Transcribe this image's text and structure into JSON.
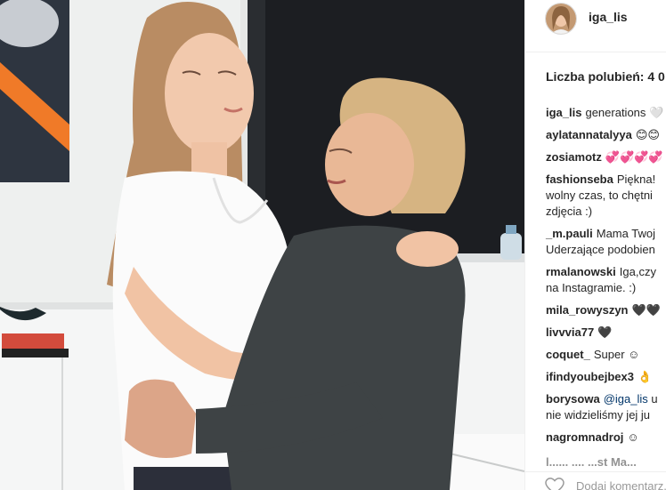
{
  "post": {
    "username": "iga_lis",
    "likes_label": "Liczba polubień: 4 0"
  },
  "comments": [
    {
      "user": "iga_lis",
      "text": "generations 🤍"
    },
    {
      "user": "aylatannatalyya",
      "text": "😊😊"
    },
    {
      "user": "zosiamotz",
      "text": "💞💞💞💞"
    },
    {
      "user": "fashionseba",
      "text": "Piękna!",
      "line2": "wolny czas, to chętni",
      "line3": "zdjęcia :)"
    },
    {
      "user": "_m.pauli",
      "text": "Mama Twoj",
      "line2": "Uderzające podobien"
    },
    {
      "user": "rmalanowski",
      "text": "Iga,czy",
      "line2": "na Instagramie. :)"
    },
    {
      "user": "mila_rowyszyn",
      "text": "🖤🖤"
    },
    {
      "user": "livvvia77",
      "text": "🖤"
    },
    {
      "user": "coquet_",
      "text": "Super ☺"
    },
    {
      "user": "ifindyoubejbex3",
      "text": "👌"
    },
    {
      "user": "borysowa",
      "mention": "@iga_lis",
      "text": "u",
      "line2": "nie widzieliśmy jej ju"
    },
    {
      "user": "nagromnadroj",
      "text": "☺"
    }
  ],
  "truncated_comment": "l...... .... ...st Ma...",
  "footer": {
    "add_comment_placeholder": "Dodaj komentarz...",
    "heart_icon": "heart-outline-icon"
  },
  "colors": {
    "text": "#262626",
    "muted": "#999999",
    "mention": "#003569",
    "border": "#efefef"
  }
}
